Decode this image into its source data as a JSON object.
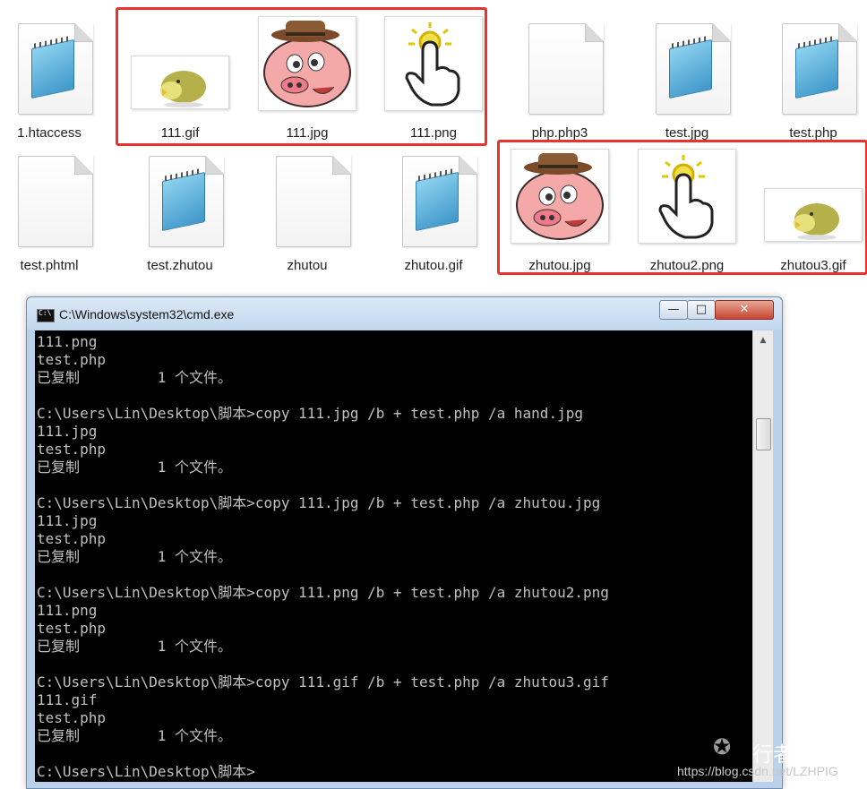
{
  "explorer": {
    "row1": [
      {
        "name": "1.htaccess",
        "type": "notepad"
      },
      {
        "name": "111.gif",
        "type": "image-chick"
      },
      {
        "name": "111.jpg",
        "type": "image-pig"
      },
      {
        "name": "111.png",
        "type": "image-hand"
      },
      {
        "name": "php.php3",
        "type": "blank"
      },
      {
        "name": "test.jpg",
        "type": "notepad"
      },
      {
        "name": "test.php",
        "type": "notepad"
      }
    ],
    "row2": [
      {
        "name": "test.phtml",
        "type": "blank"
      },
      {
        "name": "test.zhutou",
        "type": "notepad"
      },
      {
        "name": "zhutou",
        "type": "blank"
      },
      {
        "name": "zhutou.gif",
        "type": "notepad"
      },
      {
        "name": "zhutou.jpg",
        "type": "image-pig"
      },
      {
        "name": "zhutou2.png",
        "type": "image-hand"
      },
      {
        "name": "zhutou3.gif",
        "type": "image-chick"
      }
    ],
    "highlight_color": "#e8322e"
  },
  "cmd": {
    "title": "C:\\Windows\\system32\\cmd.exe",
    "buttons": {
      "minimize": "—",
      "maximize": "□",
      "close": "✕"
    },
    "lines": [
      "111.png",
      "test.php",
      "已复制         1 个文件。",
      "",
      "C:\\Users\\Lin\\Desktop\\脚本>copy 111.jpg /b + test.php /a hand.jpg",
      "111.jpg",
      "test.php",
      "已复制         1 个文件。",
      "",
      "C:\\Users\\Lin\\Desktop\\脚本>copy 111.jpg /b + test.php /a zhutou.jpg",
      "111.jpg",
      "test.php",
      "已复制         1 个文件。",
      "",
      "C:\\Users\\Lin\\Desktop\\脚本>copy 111.png /b + test.php /a zhutou2.png",
      "111.png",
      "test.php",
      "已复制         1 个文件。",
      "",
      "C:\\Users\\Lin\\Desktop\\脚本>copy 111.gif /b + test.php /a zhutou3.gif",
      "111.gif",
      "test.php",
      "已复制         1 个文件。",
      "",
      "C:\\Users\\Lin\\Desktop\\脚本>"
    ],
    "scroll_up": "▲",
    "scroll_down": "▼"
  },
  "watermark": {
    "icon": "wechat-icon",
    "text": "行者匠心",
    "url": "https://blog.csdn.net/LZHPIG"
  }
}
